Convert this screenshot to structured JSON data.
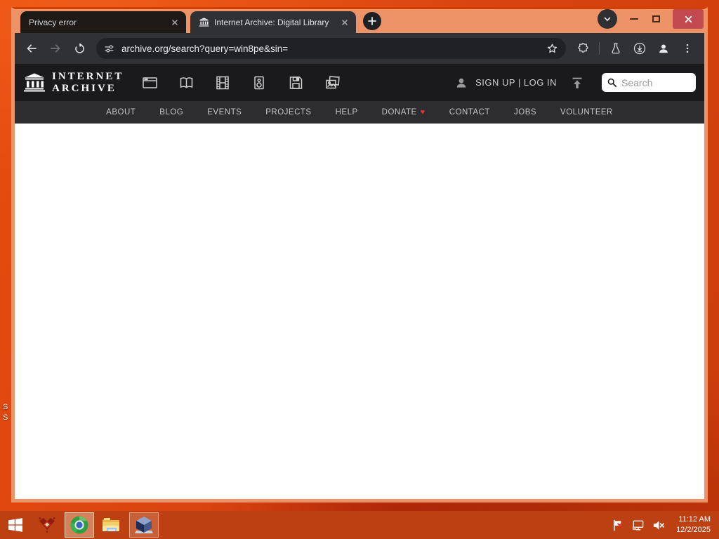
{
  "browser": {
    "tabs": [
      {
        "title": "Privacy error"
      },
      {
        "title": "Internet Archive: Digital Library"
      }
    ],
    "url": "archive.org/search?query=win8pe&sin="
  },
  "ia": {
    "logo_line1": "INTERNET",
    "logo_line2": "ARCHIVE",
    "auth": "SIGN UP | LOG IN",
    "search_placeholder": "Search",
    "nav": [
      "ABOUT",
      "BLOG",
      "EVENTS",
      "PROJECTS",
      "HELP",
      "DONATE",
      "CONTACT",
      "JOBS",
      "VOLUNTEER"
    ],
    "donate_heart": "♥",
    "media_icon_names": [
      "web-icon",
      "texts-icon",
      "video-icon",
      "audio-icon",
      "software-icon",
      "images-icon"
    ]
  },
  "desktop": {
    "icon_fragments": [
      "S",
      "S"
    ]
  },
  "taskbar": {
    "time": "11:12 AM",
    "date": "12/2/2025",
    "app_icon_names": [
      "start-icon",
      "red-app-icon",
      "chrome-icon",
      "file-explorer-icon",
      "virtualbox-icon"
    ],
    "tray_icon_names": [
      "action-center-flag-icon",
      "network-icon",
      "volume-muted-icon"
    ]
  },
  "colors": {
    "desktop": "#d84310",
    "window_frame": "#ee9267",
    "taskbar": "#bd4013",
    "toolbar_dark": "#303134",
    "ia_header": "#1a1a1c",
    "accent_heart": "#e03434",
    "close_button": "#c2494f"
  }
}
